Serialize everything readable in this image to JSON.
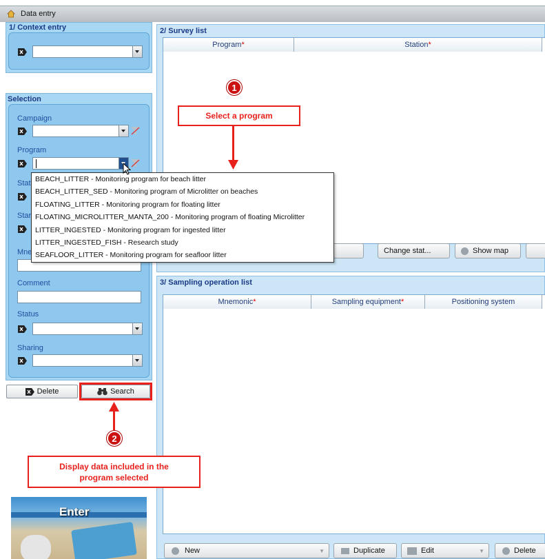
{
  "window": {
    "title": "Data entry"
  },
  "context_panel": {
    "header": "1/ Context entry"
  },
  "selection_panel": {
    "header": "Selection",
    "campaign_label": "Campaign",
    "program_label": "Program",
    "station_label_partial": "Stati",
    "start_label_partial": "Start",
    "mnemonic_label_partial": "Mne",
    "comment_label": "Comment",
    "status_label": "Status",
    "sharing_label": "Sharing",
    "delete_button": "Delete",
    "search_button": "Search"
  },
  "program_dropdown": {
    "options": [
      "BEACH_LITTER - Monitoring program for beach litter",
      "BEACH_LITTER_SED - Monitoring program of Microlitter on beaches",
      "FLOATING_LITTER - Monitoring program for floating litter",
      "FLOATING_MICROLITTER_MANTA_200 - Monitoring program of floating Microlitter",
      "LITTER_INGESTED - Monitoring program for ingested litter",
      "LITTER_INGESTED_FISH - Research study",
      "SEAFLOOR_LITTER - Monitoring program for seafloor litter"
    ]
  },
  "survey_list": {
    "header": "2/ Survey list",
    "columns": [
      {
        "label": "Program",
        "required": "*"
      },
      {
        "label": "Station",
        "required": "*"
      }
    ],
    "hidden_buttons": [
      "Change stat...",
      "Show map"
    ]
  },
  "sampling_list": {
    "header": "3/ Sampling operation list",
    "columns": [
      {
        "label": "Mnemonic",
        "required": "*"
      },
      {
        "label": "Sampling equipment",
        "required": "*"
      },
      {
        "label": "Positioning system",
        "required": ""
      }
    ],
    "toolbar": {
      "new": "New",
      "duplicate": "Duplicate",
      "edit": "Edit",
      "delete": "Delete"
    }
  },
  "annotations": {
    "step1_number": "1",
    "step1_text": "Select a program",
    "step2_number": "2",
    "step2_text": "Display data included in the program selected"
  },
  "thumbnail": {
    "caption": "Enter"
  },
  "colors": {
    "accent_red": "#e8211c",
    "panel_blue": "#a8d7f4",
    "header_blue": "#1a3a86"
  }
}
